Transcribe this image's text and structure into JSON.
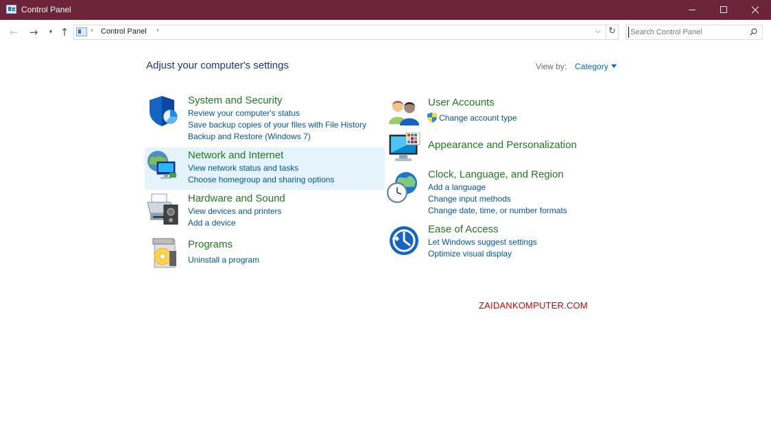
{
  "window": {
    "title": "Control Panel"
  },
  "address": {
    "breadcrumb": "Control Panel",
    "search_placeholder": "Search Control Panel"
  },
  "header": {
    "title": "Adjust your computer's settings",
    "view_by_label": "View by:",
    "view_by_value": "Category"
  },
  "categories": {
    "system_security": {
      "title": "System and Security",
      "icon": "shield-icon",
      "links": [
        "Review your computer's status",
        "Save backup copies of your files with File History",
        "Backup and Restore (Windows 7)"
      ]
    },
    "network_internet": {
      "title": "Network and Internet",
      "icon": "network-globe-icon",
      "links": [
        "View network status and tasks",
        "Choose homegroup and sharing options"
      ]
    },
    "hardware_sound": {
      "title": "Hardware and Sound",
      "icon": "printer-speaker-icon",
      "links": [
        "View devices and printers",
        "Add a device"
      ]
    },
    "programs": {
      "title": "Programs",
      "icon": "programs-disc-icon",
      "links": [
        "Uninstall a program"
      ]
    },
    "user_accounts": {
      "title": "User Accounts",
      "icon": "users-icon",
      "links": [
        "Change account type"
      ]
    },
    "appearance": {
      "title": "Appearance and Personalization",
      "icon": "monitor-palette-icon",
      "links": []
    },
    "clock_region": {
      "title": "Clock, Language, and Region",
      "icon": "clock-globe-icon",
      "links": [
        "Add a language",
        "Change input methods",
        "Change date, time, or number formats"
      ]
    },
    "ease_access": {
      "title": "Ease of Access",
      "icon": "ease-of-access-icon",
      "links": [
        "Let Windows suggest settings",
        "Optimize visual display"
      ]
    }
  },
  "watermark": "ZAIDANKOMPUTER.COM",
  "colors": {
    "titlebar": "#6b2439",
    "category_title": "#1e7a1e",
    "link": "#0055aa",
    "heading": "#1e3287",
    "hover_highlight": "#e5f3fb"
  }
}
